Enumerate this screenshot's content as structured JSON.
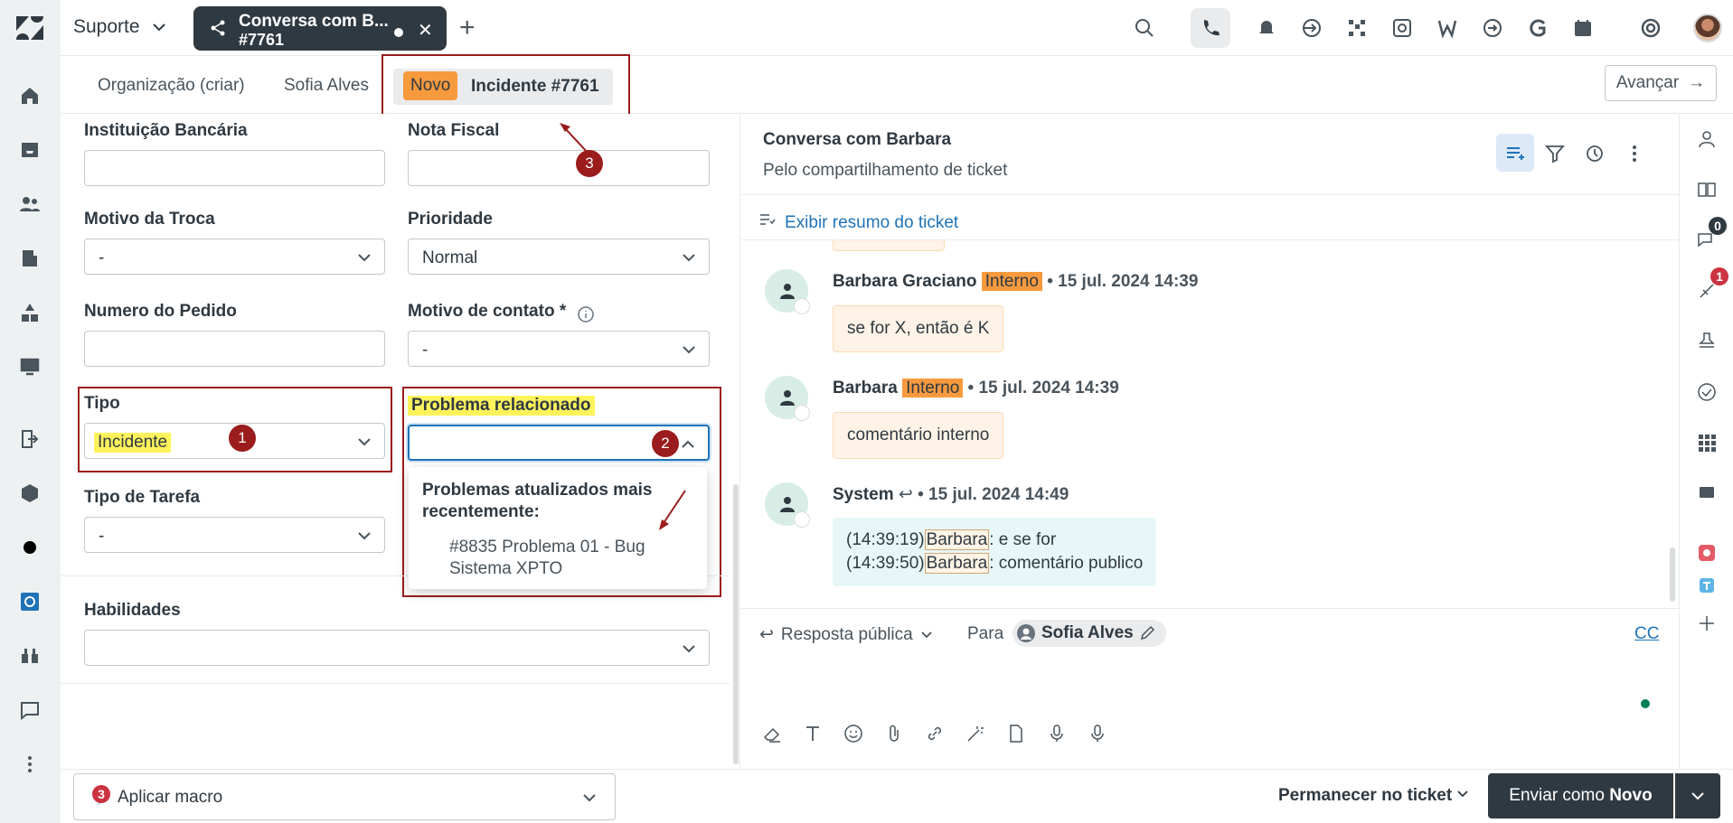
{
  "topbar": {
    "workspace": "Suporte",
    "active_tab": {
      "line1": "Conversa com B...",
      "line2": "#7761"
    }
  },
  "subtabs": {
    "org": "Organização (criar)",
    "requester": "Sofia Alves",
    "status_badge": "Novo",
    "ticket": "Incidente #7761",
    "next_button": "Avançar"
  },
  "form": {
    "instituicao_label": "Instituição Bancária",
    "instituicao_value": "",
    "nota_fiscal_label": "Nota Fiscal",
    "nota_fiscal_value": "",
    "motivo_troca_label": "Motivo da Troca",
    "motivo_troca_value": "-",
    "prioridade_label": "Prioridade",
    "prioridade_value": "Normal",
    "numero_pedido_label": "Numero do Pedido",
    "numero_pedido_value": "",
    "motivo_contato_label": "Motivo de contato *",
    "motivo_contato_value": "-",
    "tipo_label": "Tipo",
    "tipo_value": "Incidente",
    "problema_label": "Problema relacionado",
    "problema_value": "",
    "tipo_tarefa_label": "Tipo de Tarefa",
    "tipo_tarefa_value": "-",
    "habilidades_label": "Habilidades",
    "habilidades_value": "",
    "dropdown": {
      "heading": "Problemas atualizados mais recentemente:",
      "options": [
        "#8835 Problema 01  - Bug Sistema XPTO"
      ]
    }
  },
  "annotations": {
    "n1": "1",
    "n2": "2",
    "n3": "3"
  },
  "conversation": {
    "title": "Conversa com Barbara",
    "subtitle": "Pelo compartilhamento de ticket",
    "summary_link": "Exibir resumo do ticket",
    "messages": [
      {
        "author": "Barbara Graciano",
        "badge": "Interno",
        "time": "15 jul. 2024 14:39",
        "text": "se for X, então é K"
      },
      {
        "author": "Barbara",
        "badge": "Interno",
        "time": "15 jul. 2024 14:39",
        "text": "comentário interno"
      },
      {
        "author": "System",
        "time": "15 jul. 2024 14:49",
        "lines": [
          {
            "ts": "(14:39:19)",
            "name": "Barbara",
            "text": ": e se for"
          },
          {
            "ts": "(14:39:50)",
            "name": "Barbara",
            "text": ": comentário publico"
          }
        ]
      }
    ],
    "separator": "•"
  },
  "composer": {
    "mode": "Resposta pública",
    "to_label": "Para",
    "recipient": "Sofia Alves",
    "cc": "CC"
  },
  "rightrail": {
    "chat_badge": "0",
    "notif_badge": "1"
  },
  "bottombar": {
    "macro_label": "Aplicar macro",
    "macro_badge": "3",
    "stay": "Permanecer no ticket",
    "submit_prefix": "Enviar como ",
    "submit_status": "Novo"
  },
  "colors": {
    "accent": "#1f73b7",
    "dark": "#2f3941",
    "new_badge": "#f79a3e",
    "annot": "#9b1c1c",
    "highlight": "#fff35c"
  }
}
